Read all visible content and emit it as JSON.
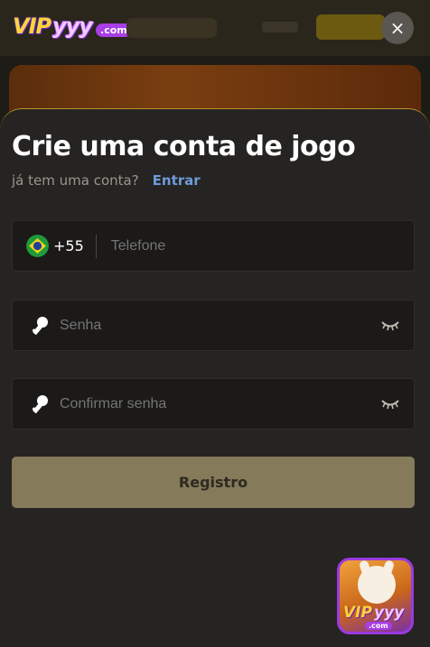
{
  "brand": {
    "logo_vip": "VIP",
    "logo_yyy": "yyy",
    "logo_com": ".com"
  },
  "close": {
    "label": "×"
  },
  "form": {
    "title": "Crie uma conta de jogo",
    "login_prompt": "já tem uma conta?",
    "login_link": "Entrar",
    "phone": {
      "country_flag": "brazil-flag-icon",
      "country_code": "+55",
      "placeholder": "Telefone",
      "value": ""
    },
    "password": {
      "icon": "key-icon",
      "placeholder": "Senha",
      "value": ""
    },
    "confirm_password": {
      "icon": "key-icon",
      "placeholder": "Confirmar senha",
      "value": ""
    },
    "submit_label": "Registro"
  },
  "app_icon": {
    "vip": "VIP",
    "yyy": "yyy",
    "com": ".com"
  },
  "colors": {
    "background": "#1d1b16",
    "sheet": "#252422",
    "sheet_border": "#b9932e",
    "link": "#6f9ad8",
    "button": "#857a5a"
  }
}
